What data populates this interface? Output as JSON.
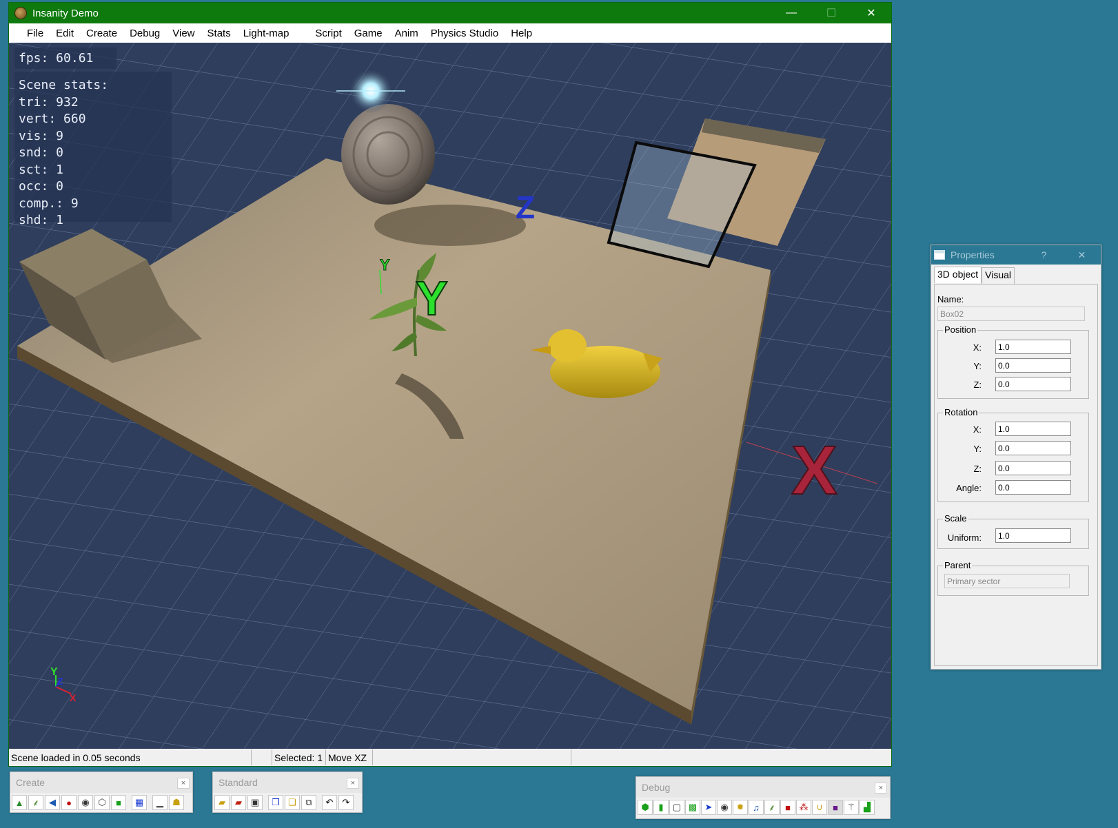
{
  "window": {
    "title": "Insanity Demo",
    "minimize": "—",
    "maximize": "☐",
    "close": "✕"
  },
  "menu": [
    "File",
    "Edit",
    "Create",
    "Debug",
    "View",
    "Stats",
    "Light-map",
    "Script",
    "Game",
    "Anim",
    "Physics Studio",
    "Help"
  ],
  "overlay": {
    "fps": "fps: 60.61",
    "stats_title": "Scene stats:",
    "stats": [
      "tri: 932",
      "vert: 660",
      "vis: 9",
      "snd: 0",
      "sct: 1",
      "occ: 0",
      "comp.: 9",
      "shd: 1"
    ]
  },
  "scene": {
    "gizmo_y_small": "Y",
    "gizmo_y_big": "Y",
    "gizmo_z_big": "Z",
    "gizmo_x_big": "X",
    "axis_y": "Y",
    "axis_z": "Z",
    "axis_x": "X",
    "colors": {
      "grid_bg": "#2f3e5c",
      "ground": "#a89378",
      "duck": "#d4b224",
      "sphere": "#8a8078"
    }
  },
  "status": {
    "message": "Scene loaded in 0.05 seconds",
    "selected": "Selected: 1",
    "mode": "Move XZ"
  },
  "properties": {
    "title": "Properties",
    "help": "?",
    "close": "✕",
    "tabs": [
      "3D object",
      "Visual"
    ],
    "name_label": "Name:",
    "name_value": "Box02",
    "position": {
      "title": "Position",
      "x_label": "X:",
      "x": "1.0",
      "y_label": "Y:",
      "y": "0.0",
      "z_label": "Z:",
      "z": "0.0"
    },
    "rotation": {
      "title": "Rotation",
      "x_label": "X:",
      "x": "1.0",
      "y_label": "Y:",
      "y": "0.0",
      "z_label": "Z:",
      "z": "0.0",
      "angle_label": "Angle:",
      "angle": "0.0"
    },
    "scale": {
      "title": "Scale",
      "uniform_label": "Uniform:",
      "uniform": "1.0"
    },
    "parent": {
      "title": "Parent",
      "value": "Primary sector"
    }
  },
  "toolbars": {
    "create": {
      "title": "Create",
      "close": "×",
      "icons": [
        "tree-icon",
        "plant-icon",
        "speaker-icon",
        "particles-icon",
        "camera-icon",
        "cube-wire-icon",
        "cube-green-icon",
        "bsp-icon",
        "floor-icon",
        "lamp-icon"
      ]
    },
    "standard": {
      "title": "Standard",
      "close": "×",
      "icons": [
        "open-icon",
        "open-red-icon",
        "save-icon",
        "copy-icon",
        "paste-icon",
        "duplicate-icon",
        "undo-icon",
        "redo-icon"
      ]
    },
    "debug": {
      "title": "Debug",
      "close": "×",
      "icons": [
        "box-icon",
        "cylinder-icon",
        "box-outline-icon",
        "map-icon",
        "cursor-icon",
        "camera-icon",
        "burst-icon",
        "note-icon",
        "plant-icon",
        "cube-red-icon",
        "nodes-icon",
        "magnet-icon",
        "cube-purple-icon",
        "wand-icon",
        "chart-icon"
      ]
    }
  }
}
